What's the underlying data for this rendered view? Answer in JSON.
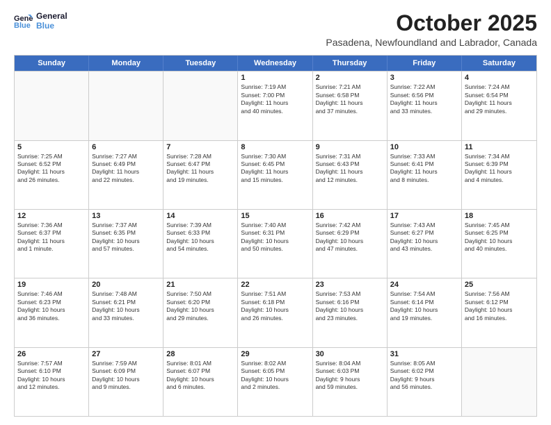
{
  "logo": {
    "line1": "General",
    "line2": "Blue"
  },
  "title": "October 2025",
  "subtitle": "Pasadena, Newfoundland and Labrador, Canada",
  "header_days": [
    "Sunday",
    "Monday",
    "Tuesday",
    "Wednesday",
    "Thursday",
    "Friday",
    "Saturday"
  ],
  "weeks": [
    [
      {
        "day": "",
        "lines": []
      },
      {
        "day": "",
        "lines": []
      },
      {
        "day": "",
        "lines": []
      },
      {
        "day": "1",
        "lines": [
          "Sunrise: 7:19 AM",
          "Sunset: 7:00 PM",
          "Daylight: 11 hours",
          "and 40 minutes."
        ]
      },
      {
        "day": "2",
        "lines": [
          "Sunrise: 7:21 AM",
          "Sunset: 6:58 PM",
          "Daylight: 11 hours",
          "and 37 minutes."
        ]
      },
      {
        "day": "3",
        "lines": [
          "Sunrise: 7:22 AM",
          "Sunset: 6:56 PM",
          "Daylight: 11 hours",
          "and 33 minutes."
        ]
      },
      {
        "day": "4",
        "lines": [
          "Sunrise: 7:24 AM",
          "Sunset: 6:54 PM",
          "Daylight: 11 hours",
          "and 29 minutes."
        ]
      }
    ],
    [
      {
        "day": "5",
        "lines": [
          "Sunrise: 7:25 AM",
          "Sunset: 6:52 PM",
          "Daylight: 11 hours",
          "and 26 minutes."
        ]
      },
      {
        "day": "6",
        "lines": [
          "Sunrise: 7:27 AM",
          "Sunset: 6:49 PM",
          "Daylight: 11 hours",
          "and 22 minutes."
        ]
      },
      {
        "day": "7",
        "lines": [
          "Sunrise: 7:28 AM",
          "Sunset: 6:47 PM",
          "Daylight: 11 hours",
          "and 19 minutes."
        ]
      },
      {
        "day": "8",
        "lines": [
          "Sunrise: 7:30 AM",
          "Sunset: 6:45 PM",
          "Daylight: 11 hours",
          "and 15 minutes."
        ]
      },
      {
        "day": "9",
        "lines": [
          "Sunrise: 7:31 AM",
          "Sunset: 6:43 PM",
          "Daylight: 11 hours",
          "and 12 minutes."
        ]
      },
      {
        "day": "10",
        "lines": [
          "Sunrise: 7:33 AM",
          "Sunset: 6:41 PM",
          "Daylight: 11 hours",
          "and 8 minutes."
        ]
      },
      {
        "day": "11",
        "lines": [
          "Sunrise: 7:34 AM",
          "Sunset: 6:39 PM",
          "Daylight: 11 hours",
          "and 4 minutes."
        ]
      }
    ],
    [
      {
        "day": "12",
        "lines": [
          "Sunrise: 7:36 AM",
          "Sunset: 6:37 PM",
          "Daylight: 11 hours",
          "and 1 minute."
        ]
      },
      {
        "day": "13",
        "lines": [
          "Sunrise: 7:37 AM",
          "Sunset: 6:35 PM",
          "Daylight: 10 hours",
          "and 57 minutes."
        ]
      },
      {
        "day": "14",
        "lines": [
          "Sunrise: 7:39 AM",
          "Sunset: 6:33 PM",
          "Daylight: 10 hours",
          "and 54 minutes."
        ]
      },
      {
        "day": "15",
        "lines": [
          "Sunrise: 7:40 AM",
          "Sunset: 6:31 PM",
          "Daylight: 10 hours",
          "and 50 minutes."
        ]
      },
      {
        "day": "16",
        "lines": [
          "Sunrise: 7:42 AM",
          "Sunset: 6:29 PM",
          "Daylight: 10 hours",
          "and 47 minutes."
        ]
      },
      {
        "day": "17",
        "lines": [
          "Sunrise: 7:43 AM",
          "Sunset: 6:27 PM",
          "Daylight: 10 hours",
          "and 43 minutes."
        ]
      },
      {
        "day": "18",
        "lines": [
          "Sunrise: 7:45 AM",
          "Sunset: 6:25 PM",
          "Daylight: 10 hours",
          "and 40 minutes."
        ]
      }
    ],
    [
      {
        "day": "19",
        "lines": [
          "Sunrise: 7:46 AM",
          "Sunset: 6:23 PM",
          "Daylight: 10 hours",
          "and 36 minutes."
        ]
      },
      {
        "day": "20",
        "lines": [
          "Sunrise: 7:48 AM",
          "Sunset: 6:21 PM",
          "Daylight: 10 hours",
          "and 33 minutes."
        ]
      },
      {
        "day": "21",
        "lines": [
          "Sunrise: 7:50 AM",
          "Sunset: 6:20 PM",
          "Daylight: 10 hours",
          "and 29 minutes."
        ]
      },
      {
        "day": "22",
        "lines": [
          "Sunrise: 7:51 AM",
          "Sunset: 6:18 PM",
          "Daylight: 10 hours",
          "and 26 minutes."
        ]
      },
      {
        "day": "23",
        "lines": [
          "Sunrise: 7:53 AM",
          "Sunset: 6:16 PM",
          "Daylight: 10 hours",
          "and 23 minutes."
        ]
      },
      {
        "day": "24",
        "lines": [
          "Sunrise: 7:54 AM",
          "Sunset: 6:14 PM",
          "Daylight: 10 hours",
          "and 19 minutes."
        ]
      },
      {
        "day": "25",
        "lines": [
          "Sunrise: 7:56 AM",
          "Sunset: 6:12 PM",
          "Daylight: 10 hours",
          "and 16 minutes."
        ]
      }
    ],
    [
      {
        "day": "26",
        "lines": [
          "Sunrise: 7:57 AM",
          "Sunset: 6:10 PM",
          "Daylight: 10 hours",
          "and 12 minutes."
        ]
      },
      {
        "day": "27",
        "lines": [
          "Sunrise: 7:59 AM",
          "Sunset: 6:09 PM",
          "Daylight: 10 hours",
          "and 9 minutes."
        ]
      },
      {
        "day": "28",
        "lines": [
          "Sunrise: 8:01 AM",
          "Sunset: 6:07 PM",
          "Daylight: 10 hours",
          "and 6 minutes."
        ]
      },
      {
        "day": "29",
        "lines": [
          "Sunrise: 8:02 AM",
          "Sunset: 6:05 PM",
          "Daylight: 10 hours",
          "and 2 minutes."
        ]
      },
      {
        "day": "30",
        "lines": [
          "Sunrise: 8:04 AM",
          "Sunset: 6:03 PM",
          "Daylight: 9 hours",
          "and 59 minutes."
        ]
      },
      {
        "day": "31",
        "lines": [
          "Sunrise: 8:05 AM",
          "Sunset: 6:02 PM",
          "Daylight: 9 hours",
          "and 56 minutes."
        ]
      },
      {
        "day": "",
        "lines": []
      }
    ]
  ]
}
